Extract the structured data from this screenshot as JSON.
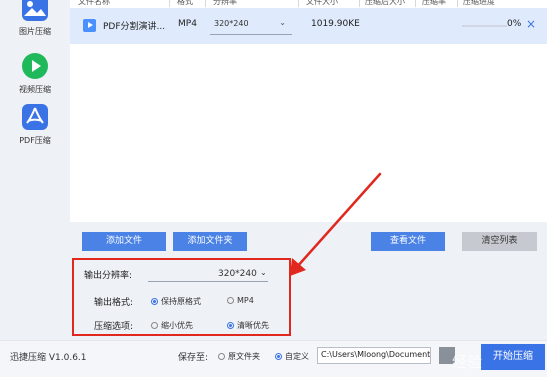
{
  "sidebar": {
    "items": [
      {
        "label": "图片压缩",
        "icon": "image-icon"
      },
      {
        "label": "视频压缩",
        "icon": "play-icon"
      },
      {
        "label": "PDF压缩",
        "icon": "pdf-icon"
      }
    ]
  },
  "table": {
    "headers": [
      "文件名称",
      "格式",
      "分辨率",
      "文件大小",
      "压缩后大小",
      "压缩率",
      "压缩进度"
    ],
    "rows": [
      {
        "name": "PDF分割演讲...",
        "format": "MP4",
        "resolution": "320*240",
        "size": "1019.90KE",
        "progress": "0%",
        "progress_value": 0
      }
    ]
  },
  "buttons": {
    "add_file": "添加文件",
    "add_folder": "添加文件夹",
    "view_file": "查看文件",
    "clear_list": "清空列表",
    "start": "开始压缩"
  },
  "settings": {
    "resolution_label": "输出分辨率:",
    "resolution_value": "320*240",
    "format_label": "输出格式:",
    "format_options": [
      "保持原格式",
      "MP4"
    ],
    "format_selected": 0,
    "compress_label": "压缩选项:",
    "compress_options": [
      "缩小优先",
      "清晰优先"
    ],
    "compress_selected": 1
  },
  "footer": {
    "version": "迅捷压缩 V1.0.6.1",
    "save_label": "保存至:",
    "save_options": [
      "原文件夹",
      "自定义"
    ],
    "save_selected": 1,
    "path": "C:\\Users\\Mloong\\Documents"
  },
  "watermark": "经验",
  "colors": {
    "accent": "#3a73e6",
    "highlight_border": "#e0281e"
  }
}
